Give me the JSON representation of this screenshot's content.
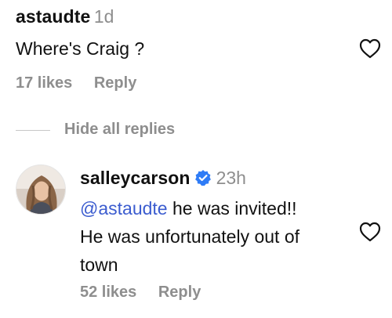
{
  "top_comment": {
    "username": "astaudte",
    "time": "1d",
    "text": "Where's Craig ?",
    "likes": "17 likes",
    "reply_label": "Reply"
  },
  "replies_toggle": {
    "label": "Hide all replies"
  },
  "reply_comment": {
    "username": "salleycarson",
    "time": "23h",
    "mention": "@astaudte",
    "text_after_mention": "he was invited!!",
    "line2": "He was unfortunately out of",
    "line3": "town",
    "likes": "52 likes",
    "reply_label": "Reply"
  },
  "colors": {
    "text": "#111111",
    "muted": "#8e8e8e",
    "mention": "#3b5ccf",
    "verified": "#2f7cf6"
  }
}
